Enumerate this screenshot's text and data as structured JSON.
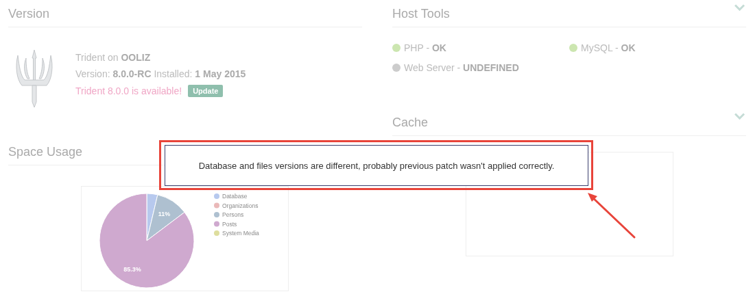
{
  "version": {
    "title": "Version",
    "product": "Trident",
    "on_label": "on",
    "site": "OOLIZ",
    "version_label": "Version:",
    "version": "8.0.0-RC",
    "installed_label": "Installed:",
    "installed": "1 May 2015",
    "update_notice": "Trident 8.0.0 is available!",
    "update_button": "Update"
  },
  "host_tools": {
    "title": "Host Tools",
    "expanded": true,
    "separator": "-",
    "items": [
      {
        "name": "PHP",
        "status": "OK",
        "color": "#cce6b0"
      },
      {
        "name": "MySQL",
        "status": "OK",
        "color": "#cce6b0"
      },
      {
        "name": "Web Server",
        "status": "UNDEFINED",
        "color": "#cccccc"
      }
    ]
  },
  "cache": {
    "title": "Cache",
    "expanded": true
  },
  "space_usage": {
    "title": "Space Usage",
    "chart_data": {
      "type": "pie",
      "categories": [
        "Database",
        "Organizations",
        "Persons",
        "Posts",
        "System Media"
      ],
      "values": [
        3.7,
        0,
        11,
        85.3,
        0
      ],
      "colors": [
        "#b7c9ee",
        "#eab9b9",
        "#aec0d0",
        "#cfa9cf",
        "#dede9e"
      ],
      "value_labels": [
        null,
        null,
        "11%",
        "85.3%",
        null
      ],
      "legend": "right"
    }
  },
  "alert": {
    "message": "Database and files versions are different, probably previous patch wasn't applied correctly."
  }
}
